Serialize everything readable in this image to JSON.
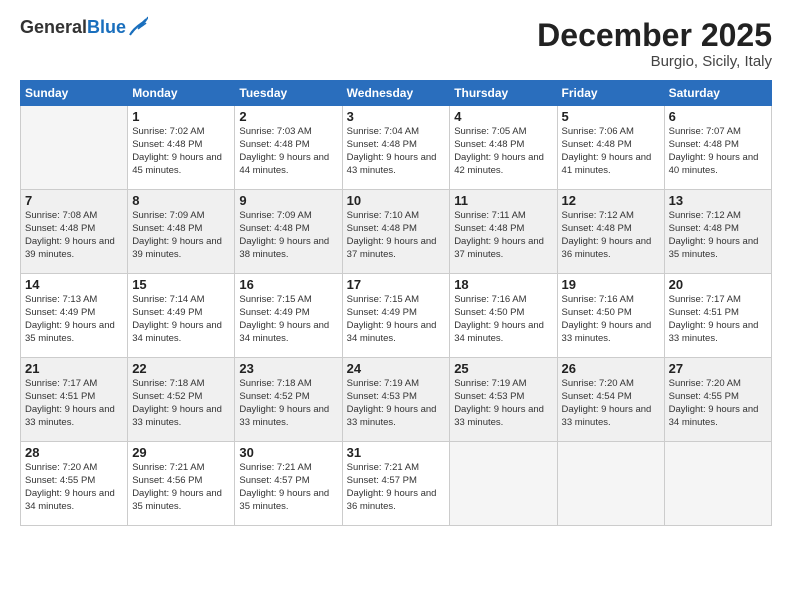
{
  "logo": {
    "general": "General",
    "blue": "Blue"
  },
  "header": {
    "month": "December 2025",
    "location": "Burgio, Sicily, Italy"
  },
  "weekdays": [
    "Sunday",
    "Monday",
    "Tuesday",
    "Wednesday",
    "Thursday",
    "Friday",
    "Saturday"
  ],
  "weeks": [
    [
      {
        "day": "",
        "sunrise": "",
        "sunset": "",
        "daylight": ""
      },
      {
        "day": "1",
        "sunrise": "Sunrise: 7:02 AM",
        "sunset": "Sunset: 4:48 PM",
        "daylight": "Daylight: 9 hours and 45 minutes."
      },
      {
        "day": "2",
        "sunrise": "Sunrise: 7:03 AM",
        "sunset": "Sunset: 4:48 PM",
        "daylight": "Daylight: 9 hours and 44 minutes."
      },
      {
        "day": "3",
        "sunrise": "Sunrise: 7:04 AM",
        "sunset": "Sunset: 4:48 PM",
        "daylight": "Daylight: 9 hours and 43 minutes."
      },
      {
        "day": "4",
        "sunrise": "Sunrise: 7:05 AM",
        "sunset": "Sunset: 4:48 PM",
        "daylight": "Daylight: 9 hours and 42 minutes."
      },
      {
        "day": "5",
        "sunrise": "Sunrise: 7:06 AM",
        "sunset": "Sunset: 4:48 PM",
        "daylight": "Daylight: 9 hours and 41 minutes."
      },
      {
        "day": "6",
        "sunrise": "Sunrise: 7:07 AM",
        "sunset": "Sunset: 4:48 PM",
        "daylight": "Daylight: 9 hours and 40 minutes."
      }
    ],
    [
      {
        "day": "7",
        "sunrise": "Sunrise: 7:08 AM",
        "sunset": "Sunset: 4:48 PM",
        "daylight": "Daylight: 9 hours and 39 minutes."
      },
      {
        "day": "8",
        "sunrise": "Sunrise: 7:09 AM",
        "sunset": "Sunset: 4:48 PM",
        "daylight": "Daylight: 9 hours and 39 minutes."
      },
      {
        "day": "9",
        "sunrise": "Sunrise: 7:09 AM",
        "sunset": "Sunset: 4:48 PM",
        "daylight": "Daylight: 9 hours and 38 minutes."
      },
      {
        "day": "10",
        "sunrise": "Sunrise: 7:10 AM",
        "sunset": "Sunset: 4:48 PM",
        "daylight": "Daylight: 9 hours and 37 minutes."
      },
      {
        "day": "11",
        "sunrise": "Sunrise: 7:11 AM",
        "sunset": "Sunset: 4:48 PM",
        "daylight": "Daylight: 9 hours and 37 minutes."
      },
      {
        "day": "12",
        "sunrise": "Sunrise: 7:12 AM",
        "sunset": "Sunset: 4:48 PM",
        "daylight": "Daylight: 9 hours and 36 minutes."
      },
      {
        "day": "13",
        "sunrise": "Sunrise: 7:12 AM",
        "sunset": "Sunset: 4:48 PM",
        "daylight": "Daylight: 9 hours and 35 minutes."
      }
    ],
    [
      {
        "day": "14",
        "sunrise": "Sunrise: 7:13 AM",
        "sunset": "Sunset: 4:49 PM",
        "daylight": "Daylight: 9 hours and 35 minutes."
      },
      {
        "day": "15",
        "sunrise": "Sunrise: 7:14 AM",
        "sunset": "Sunset: 4:49 PM",
        "daylight": "Daylight: 9 hours and 34 minutes."
      },
      {
        "day": "16",
        "sunrise": "Sunrise: 7:15 AM",
        "sunset": "Sunset: 4:49 PM",
        "daylight": "Daylight: 9 hours and 34 minutes."
      },
      {
        "day": "17",
        "sunrise": "Sunrise: 7:15 AM",
        "sunset": "Sunset: 4:49 PM",
        "daylight": "Daylight: 9 hours and 34 minutes."
      },
      {
        "day": "18",
        "sunrise": "Sunrise: 7:16 AM",
        "sunset": "Sunset: 4:50 PM",
        "daylight": "Daylight: 9 hours and 34 minutes."
      },
      {
        "day": "19",
        "sunrise": "Sunrise: 7:16 AM",
        "sunset": "Sunset: 4:50 PM",
        "daylight": "Daylight: 9 hours and 33 minutes."
      },
      {
        "day": "20",
        "sunrise": "Sunrise: 7:17 AM",
        "sunset": "Sunset: 4:51 PM",
        "daylight": "Daylight: 9 hours and 33 minutes."
      }
    ],
    [
      {
        "day": "21",
        "sunrise": "Sunrise: 7:17 AM",
        "sunset": "Sunset: 4:51 PM",
        "daylight": "Daylight: 9 hours and 33 minutes."
      },
      {
        "day": "22",
        "sunrise": "Sunrise: 7:18 AM",
        "sunset": "Sunset: 4:52 PM",
        "daylight": "Daylight: 9 hours and 33 minutes."
      },
      {
        "day": "23",
        "sunrise": "Sunrise: 7:18 AM",
        "sunset": "Sunset: 4:52 PM",
        "daylight": "Daylight: 9 hours and 33 minutes."
      },
      {
        "day": "24",
        "sunrise": "Sunrise: 7:19 AM",
        "sunset": "Sunset: 4:53 PM",
        "daylight": "Daylight: 9 hours and 33 minutes."
      },
      {
        "day": "25",
        "sunrise": "Sunrise: 7:19 AM",
        "sunset": "Sunset: 4:53 PM",
        "daylight": "Daylight: 9 hours and 33 minutes."
      },
      {
        "day": "26",
        "sunrise": "Sunrise: 7:20 AM",
        "sunset": "Sunset: 4:54 PM",
        "daylight": "Daylight: 9 hours and 33 minutes."
      },
      {
        "day": "27",
        "sunrise": "Sunrise: 7:20 AM",
        "sunset": "Sunset: 4:55 PM",
        "daylight": "Daylight: 9 hours and 34 minutes."
      }
    ],
    [
      {
        "day": "28",
        "sunrise": "Sunrise: 7:20 AM",
        "sunset": "Sunset: 4:55 PM",
        "daylight": "Daylight: 9 hours and 34 minutes."
      },
      {
        "day": "29",
        "sunrise": "Sunrise: 7:21 AM",
        "sunset": "Sunset: 4:56 PM",
        "daylight": "Daylight: 9 hours and 35 minutes."
      },
      {
        "day": "30",
        "sunrise": "Sunrise: 7:21 AM",
        "sunset": "Sunset: 4:57 PM",
        "daylight": "Daylight: 9 hours and 35 minutes."
      },
      {
        "day": "31",
        "sunrise": "Sunrise: 7:21 AM",
        "sunset": "Sunset: 4:57 PM",
        "daylight": "Daylight: 9 hours and 36 minutes."
      },
      {
        "day": "",
        "sunrise": "",
        "sunset": "",
        "daylight": ""
      },
      {
        "day": "",
        "sunrise": "",
        "sunset": "",
        "daylight": ""
      },
      {
        "day": "",
        "sunrise": "",
        "sunset": "",
        "daylight": ""
      }
    ]
  ]
}
